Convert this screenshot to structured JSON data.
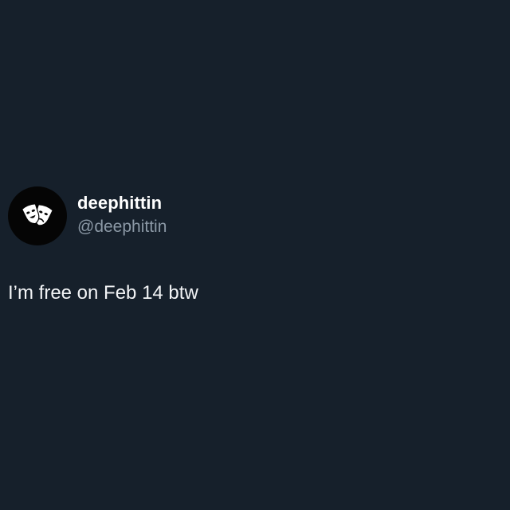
{
  "colors": {
    "background": "#16202b",
    "display_name": "#ffffff",
    "handle": "#8b98a5",
    "text": "#f2f4f6",
    "avatar_bg": "#050505"
  },
  "post": {
    "avatar_icon": "theater-masks-icon",
    "display_name": "deephittin",
    "handle": "@deephittin",
    "text": "I’m free on Feb 14 btw"
  }
}
